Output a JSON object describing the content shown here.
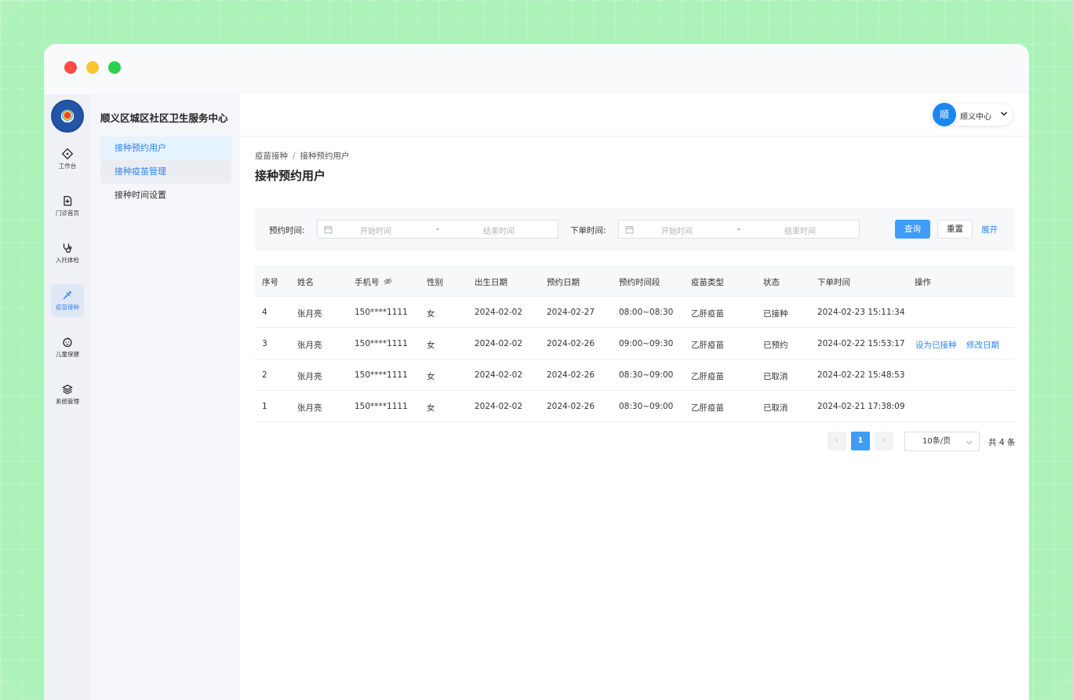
{
  "org_name": "顺义区城区社区卫生服务中心",
  "rail": [
    {
      "label": "工作台",
      "icon": "workbench-icon"
    },
    {
      "label": "门诊首页",
      "icon": "clinic-icon"
    },
    {
      "label": "入托体检",
      "icon": "stethoscope-icon"
    },
    {
      "label": "疫苗接种",
      "icon": "syringe-icon"
    },
    {
      "label": "儿童保健",
      "icon": "child-icon"
    },
    {
      "label": "系统管理",
      "icon": "layers-icon"
    }
  ],
  "menu": [
    "接种预约用户",
    "接种疫苗管理",
    "接种时间设置"
  ],
  "user": {
    "avatar": "顺",
    "name": "顺义中心"
  },
  "breadcrumb": [
    "疫苗接种",
    "接种预约用户"
  ],
  "breadcrumb_sep": "/",
  "page_title": "接种预约用户",
  "filter": {
    "appoint_label": "预约时间:",
    "order_label": "下单时间:",
    "start_ph": "开始时间",
    "end_ph": "结束时间",
    "dash": "-",
    "query": "查询",
    "reset": "重置",
    "expand": "展开"
  },
  "columns": [
    "序号",
    "姓名",
    "手机号",
    "性别",
    "出生日期",
    "预约日期",
    "预约时间段",
    "疫苗类型",
    "状态",
    "下单时间",
    "操作"
  ],
  "rows": [
    {
      "no": "4",
      "name": "张月亮",
      "phone": "150****1111",
      "gender": "女",
      "birth": "2024-02-02",
      "date": "2024-02-27",
      "slot": "08:00~08:30",
      "vaccine": "乙肝疫苗",
      "status": "已接种",
      "ordered": "2024-02-23 15:11:34",
      "op1": "",
      "op2": ""
    },
    {
      "no": "3",
      "name": "张月亮",
      "phone": "150****1111",
      "gender": "女",
      "birth": "2024-02-02",
      "date": "2024-02-26",
      "slot": "09:00~09:30",
      "vaccine": "乙肝疫苗",
      "status": "已预约",
      "ordered": "2024-02-22 15:53:17",
      "op1": "设为已接种",
      "op2": "修改日期"
    },
    {
      "no": "2",
      "name": "张月亮",
      "phone": "150****1111",
      "gender": "女",
      "birth": "2024-02-02",
      "date": "2024-02-26",
      "slot": "08:30~09:00",
      "vaccine": "乙肝疫苗",
      "status": "已取消",
      "ordered": "2024-02-22 15:48:53",
      "op1": "",
      "op2": ""
    },
    {
      "no": "1",
      "name": "张月亮",
      "phone": "150****1111",
      "gender": "女",
      "birth": "2024-02-02",
      "date": "2024-02-26",
      "slot": "08:30~09:00",
      "vaccine": "乙肝疫苗",
      "status": "已取消",
      "ordered": "2024-02-21 17:38:09",
      "op1": "",
      "op2": ""
    }
  ],
  "pagination": {
    "prev": "‹",
    "current": "1",
    "next": "›",
    "page_size": "10条/页",
    "total": "共 4 条"
  },
  "colors": {
    "primary": "#3f9cf7",
    "link": "#2e84f0",
    "avatar": "#1c86f0"
  }
}
